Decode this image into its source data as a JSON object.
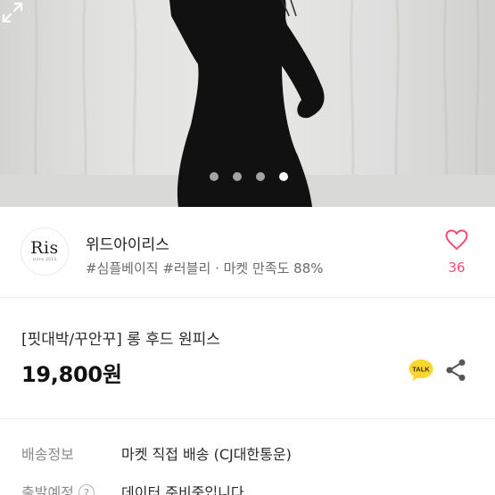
{
  "gallery": {
    "page_dots": 4,
    "active_dot": 4,
    "expand_icon": "expand-icon"
  },
  "seller": {
    "logo_text": "Ris",
    "logo_sub": "since 2013",
    "name": "위드아이리스",
    "tags": "#심플베이직 #러블리 · 마켓 만족도 88%",
    "like_icon": "heart-icon",
    "like_count": "36",
    "colors": {
      "like": "#f0506e"
    }
  },
  "product": {
    "title": "[핏대박/꾸안꾸] 롱 후드 원피스",
    "price": "19,800원",
    "talk_label": "TALK",
    "share_icon": "share-icon"
  },
  "shipping": {
    "rows": [
      {
        "label": "배송정보",
        "value": "마켓 직접 배송 (CJ대한통운)"
      },
      {
        "label": "출발예정",
        "value": "데이터 준비중입니다",
        "help": "?"
      }
    ]
  }
}
